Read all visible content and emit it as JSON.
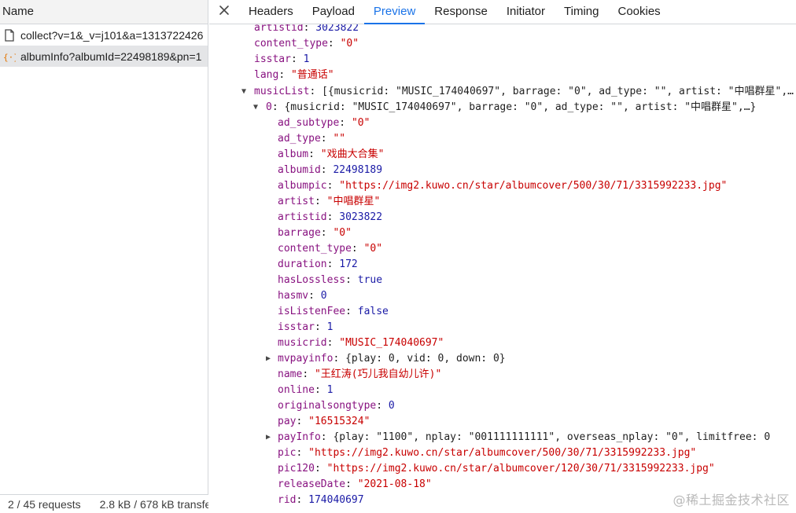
{
  "left": {
    "header": "Name",
    "requests": [
      {
        "name": "collect?v=1&_v=j101&a=1313722426",
        "icon": "document-icon",
        "selected": false
      },
      {
        "name": "albumInfo?albumId=22498189&pn=1",
        "icon": "json-icon",
        "selected": true
      }
    ],
    "status": {
      "requests": "2 / 45 requests",
      "transfer": "2.8 kB / 678 kB transferred"
    }
  },
  "tabs": [
    "Headers",
    "Payload",
    "Preview",
    "Response",
    "Initiator",
    "Timing",
    "Cookies"
  ],
  "active_tab": "Preview",
  "colors": {
    "key": "#881280",
    "string": "#c80000",
    "number": "#1a1aa6",
    "accent": "#1a73e8"
  },
  "preview": {
    "top_fields": [
      {
        "key": "artistid",
        "value": "3023822",
        "type": "n"
      },
      {
        "key": "content_type",
        "value": "\"0\"",
        "type": "s"
      },
      {
        "key": "isstar",
        "value": "1",
        "type": "n"
      },
      {
        "key": "lang",
        "value": "\"普通话\"",
        "type": "s"
      }
    ],
    "musicList_key": "musicList",
    "musicList_summary": "[{musicrid: \"MUSIC_174040697\", barrage: \"0\", ad_type: \"\", artist: \"中唱群星\",…",
    "item0_key": "0",
    "item0_summary": "{musicrid: \"MUSIC_174040697\", barrage: \"0\", ad_type: \"\", artist: \"中唱群星\",…}",
    "item_fields": [
      {
        "key": "ad_subtype",
        "value": "\"0\"",
        "type": "s"
      },
      {
        "key": "ad_type",
        "value": "\"\"",
        "type": "s"
      },
      {
        "key": "album",
        "value": "\"戏曲大合集\"",
        "type": "s"
      },
      {
        "key": "albumid",
        "value": "22498189",
        "type": "n"
      },
      {
        "key": "albumpic",
        "value": "\"https://img2.kuwo.cn/star/albumcover/500/30/71/3315992233.jpg\"",
        "type": "s"
      },
      {
        "key": "artist",
        "value": "\"中唱群星\"",
        "type": "s"
      },
      {
        "key": "artistid",
        "value": "3023822",
        "type": "n"
      },
      {
        "key": "barrage",
        "value": "\"0\"",
        "type": "s"
      },
      {
        "key": "content_type",
        "value": "\"0\"",
        "type": "s"
      },
      {
        "key": "duration",
        "value": "172",
        "type": "n"
      },
      {
        "key": "hasLossless",
        "value": "true",
        "type": "b"
      },
      {
        "key": "hasmv",
        "value": "0",
        "type": "n"
      },
      {
        "key": "isListenFee",
        "value": "false",
        "type": "b"
      },
      {
        "key": "isstar",
        "value": "1",
        "type": "n"
      },
      {
        "key": "musicrid",
        "value": "\"MUSIC_174040697\"",
        "type": "s"
      },
      {
        "key": "mvpayinfo",
        "value": "{play: 0, vid: 0, down: 0}",
        "type": "summary",
        "collapsible": true
      },
      {
        "key": "name",
        "value": "\"王红涛(巧儿我自幼儿许)\"",
        "type": "s"
      },
      {
        "key": "online",
        "value": "1",
        "type": "n"
      },
      {
        "key": "originalsongtype",
        "value": "0",
        "type": "n"
      },
      {
        "key": "pay",
        "value": "\"16515324\"",
        "type": "s"
      },
      {
        "key": "payInfo",
        "value": "{play: \"1100\", nplay: \"001111111111\", overseas_nplay: \"0\", limitfree: 0",
        "type": "summary",
        "collapsible": true
      },
      {
        "key": "pic",
        "value": "\"https://img2.kuwo.cn/star/albumcover/500/30/71/3315992233.jpg\"",
        "type": "s"
      },
      {
        "key": "pic120",
        "value": "\"https://img2.kuwo.cn/star/albumcover/120/30/71/3315992233.jpg\"",
        "type": "s"
      },
      {
        "key": "releaseDate",
        "value": "\"2021-08-18\"",
        "type": "s"
      },
      {
        "key": "rid",
        "value": "174040697",
        "type": "n"
      }
    ]
  },
  "watermark": "@稀土掘金技术社区"
}
